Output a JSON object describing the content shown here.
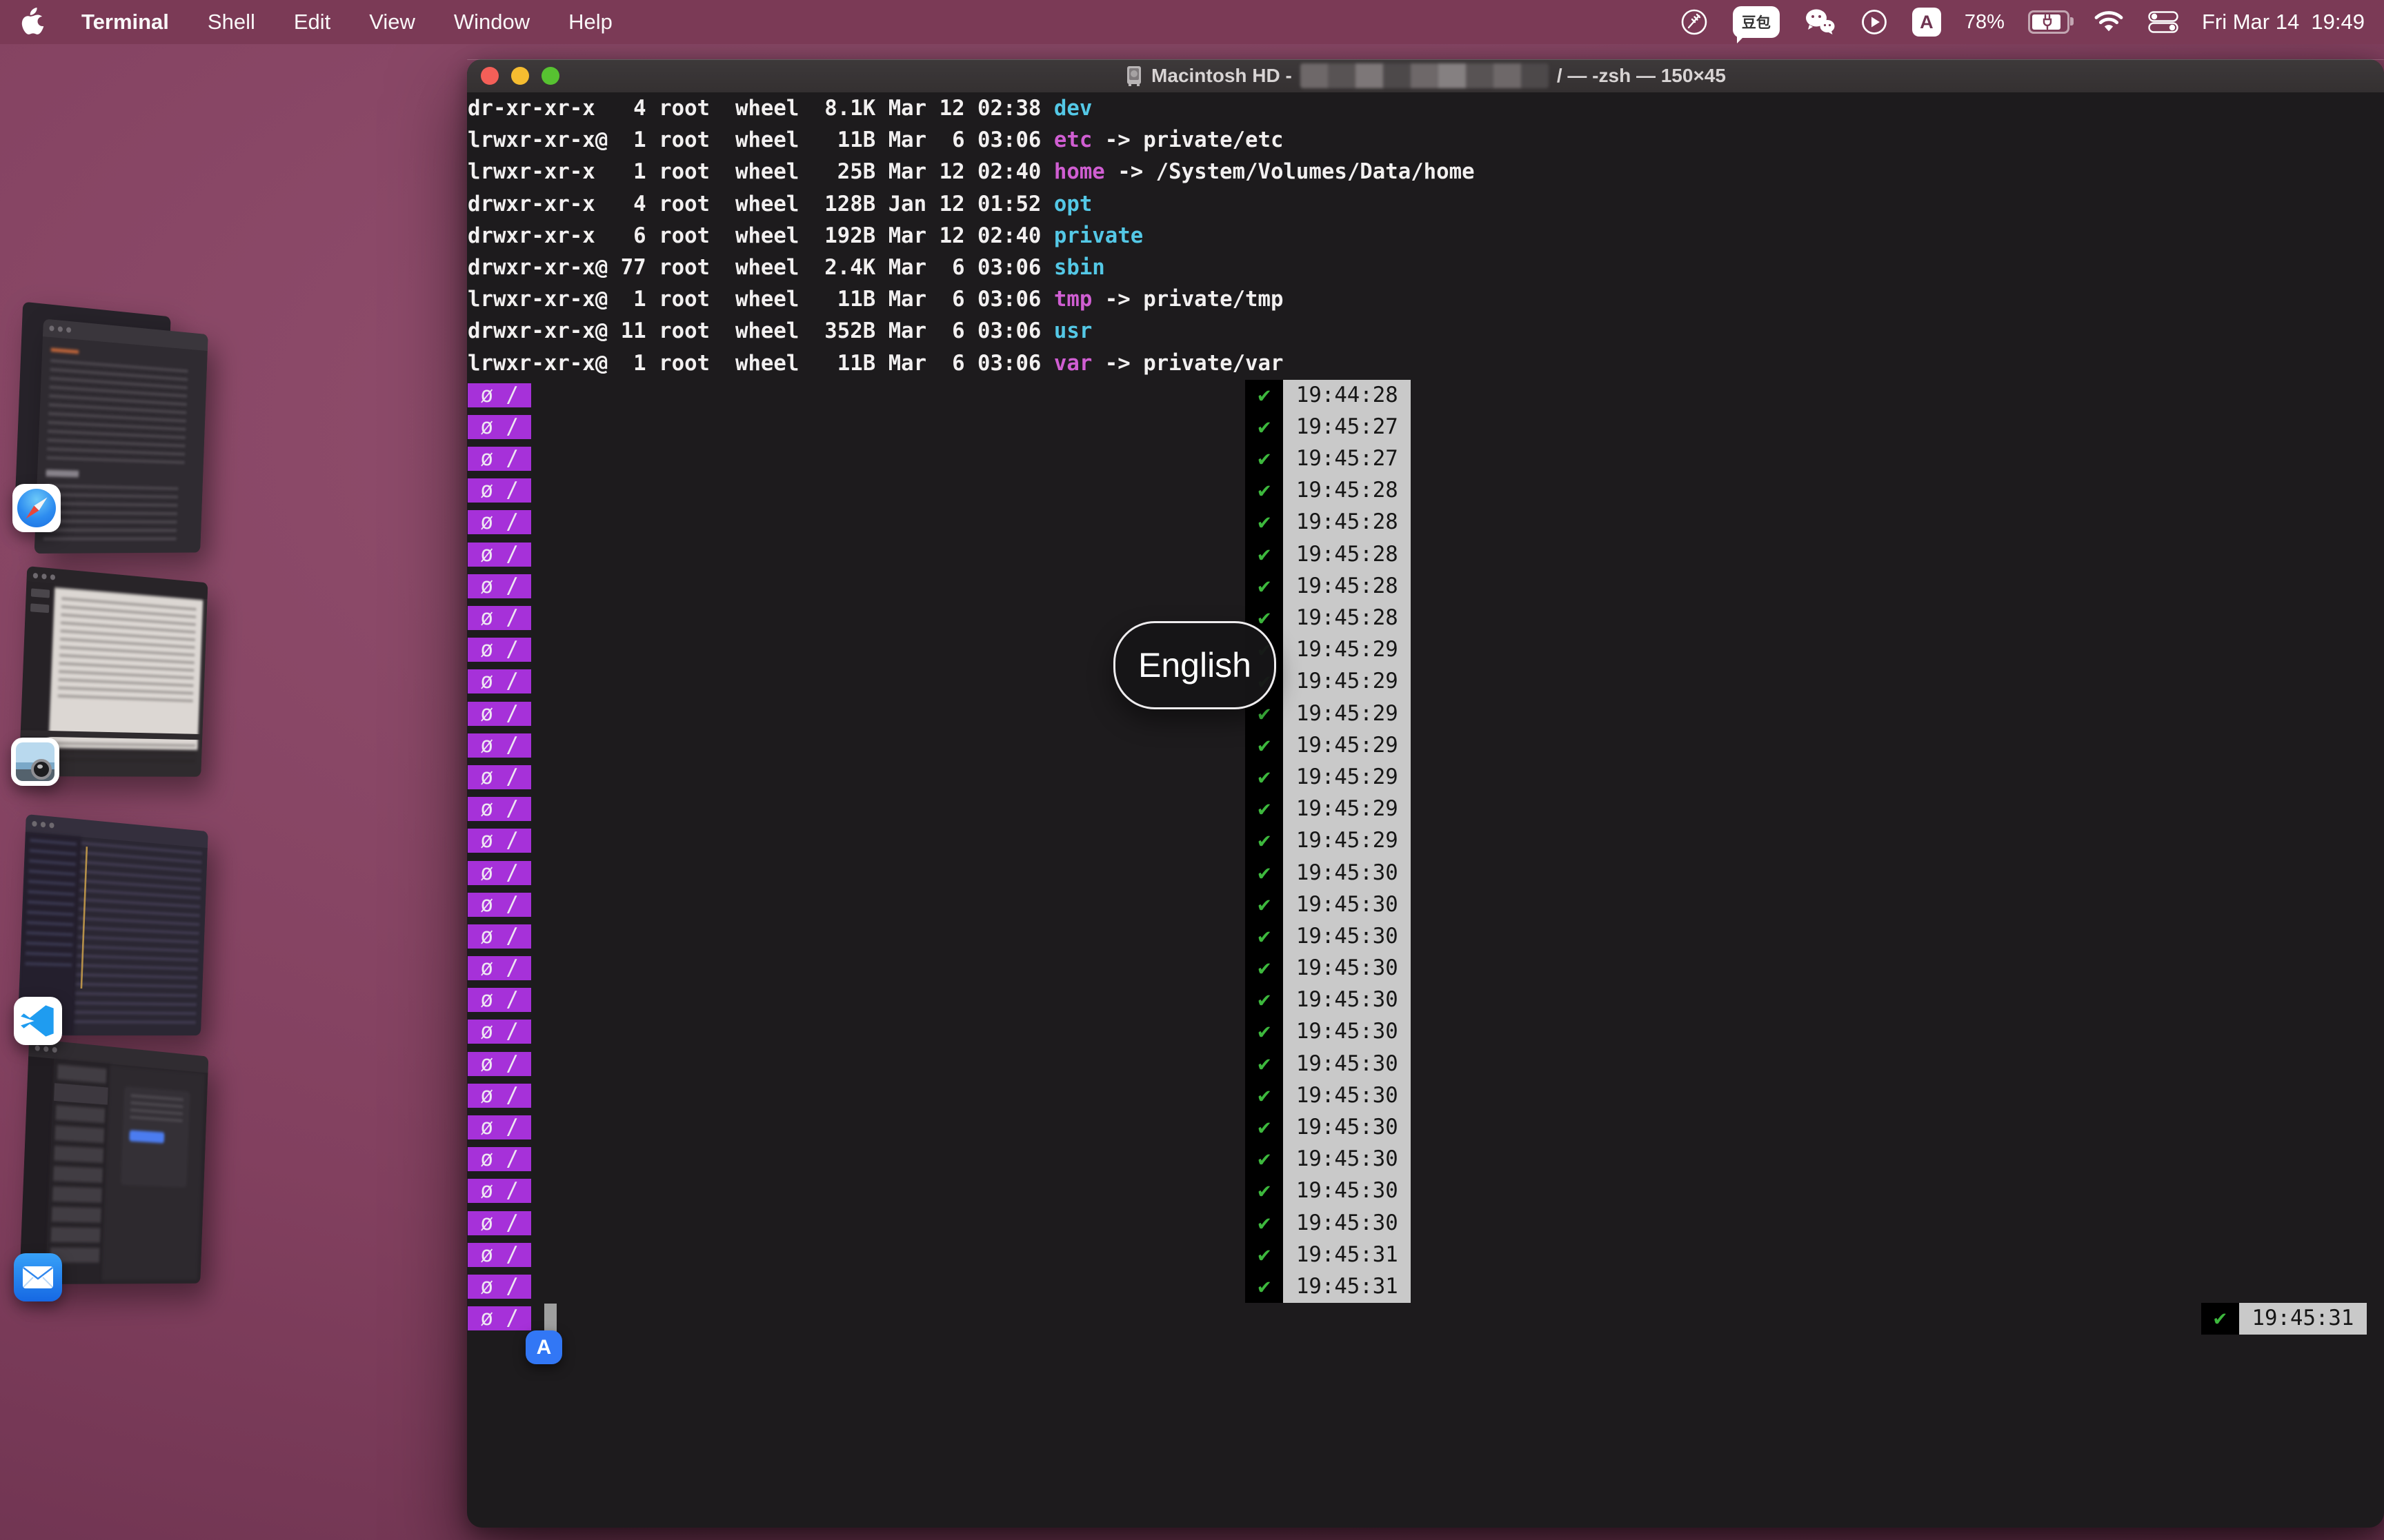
{
  "menu": {
    "items": [
      "Terminal",
      "Shell",
      "Edit",
      "View",
      "Window",
      "Help"
    ],
    "active": "Terminal"
  },
  "status": {
    "doubao": "豆包",
    "input_badge": "A",
    "battery": "78%",
    "clock": "Fri Mar 14  19:49",
    "icons": [
      "circled-utensil-icon",
      "doubao-chat-icon",
      "wechat-icon",
      "play-circle-icon",
      "input-source-icon",
      "battery-charging-icon",
      "wifi-icon",
      "control-center-icon"
    ]
  },
  "window_title": {
    "volume": "Macintosh HD -",
    "session": "/ — -zsh — 150×45"
  },
  "terminal": {
    "ls": [
      {
        "pre": "dr-xr-xr-x   4 root  wheel  8.1K Mar 12 02:38 ",
        "name": "dev",
        "color": "cyan",
        "link": ""
      },
      {
        "pre": "lrwxr-xr-x@  1 root  wheel   11B Mar  6 03:06 ",
        "name": "etc",
        "color": "magenta",
        "link": " -> private/etc"
      },
      {
        "pre": "lrwxr-xr-x   1 root  wheel   25B Mar 12 02:40 ",
        "name": "home",
        "color": "magenta",
        "link": " -> /System/Volumes/Data/home"
      },
      {
        "pre": "drwxr-xr-x   4 root  wheel  128B Jan 12 01:52 ",
        "name": "opt",
        "color": "cyan",
        "link": ""
      },
      {
        "pre": "drwxr-xr-x   6 root  wheel  192B Mar 12 02:40 ",
        "name": "private",
        "color": "cyan",
        "link": ""
      },
      {
        "pre": "drwxr-xr-x@ 77 root  wheel  2.4K Mar  6 03:06 ",
        "name": "sbin",
        "color": "cyan",
        "link": ""
      },
      {
        "pre": "lrwxr-xr-x@  1 root  wheel   11B Mar  6 03:06 ",
        "name": "tmp",
        "color": "magenta",
        "link": " -> private/tmp"
      },
      {
        "pre": "drwxr-xr-x@ 11 root  wheel  352B Mar  6 03:06 ",
        "name": "usr",
        "color": "cyan",
        "link": ""
      },
      {
        "pre": "lrwxr-xr-x@  1 root  wheel   11B Mar  6 03:06 ",
        "name": "var",
        "color": "magenta",
        "link": " -> private/var"
      }
    ],
    "prompt": " ø / ",
    "check": "✔",
    "prompt_rows": 30,
    "timestamps": [
      "19:44:28",
      "19:45:27",
      "19:45:27",
      "19:45:28",
      "19:45:28",
      "19:45:28",
      "19:45:28",
      "19:45:28",
      "19:45:29",
      "19:45:29",
      "19:45:29",
      "19:45:29",
      "19:45:29",
      "19:45:29",
      "19:45:29",
      "19:45:30",
      "19:45:30",
      "19:45:30",
      "19:45:30",
      "19:45:30",
      "19:45:30",
      "19:45:30",
      "19:45:30",
      "19:45:30",
      "19:45:30",
      "19:45:30",
      "19:45:30",
      "19:45:31",
      "19:45:31"
    ],
    "current_time": "19:45:31"
  },
  "overlays": {
    "input_source_popup": "English",
    "input_indicator": "A"
  },
  "stage_manager": {
    "apps": [
      "Safari",
      "Preview",
      "Visual Studio Code",
      "Mail"
    ]
  },
  "colors": {
    "menubar": "#7b3a56",
    "terminal_bg": "#1d1b1d",
    "titlebar": "#373334",
    "prompt_purple": "#a631d9",
    "dir_cyan": "#54c8e6",
    "symlink_magenta": "#d05ed2",
    "check_green": "#3db83d",
    "time_bg": "#c9c9c9",
    "input_badge_blue": "#3277f5"
  }
}
